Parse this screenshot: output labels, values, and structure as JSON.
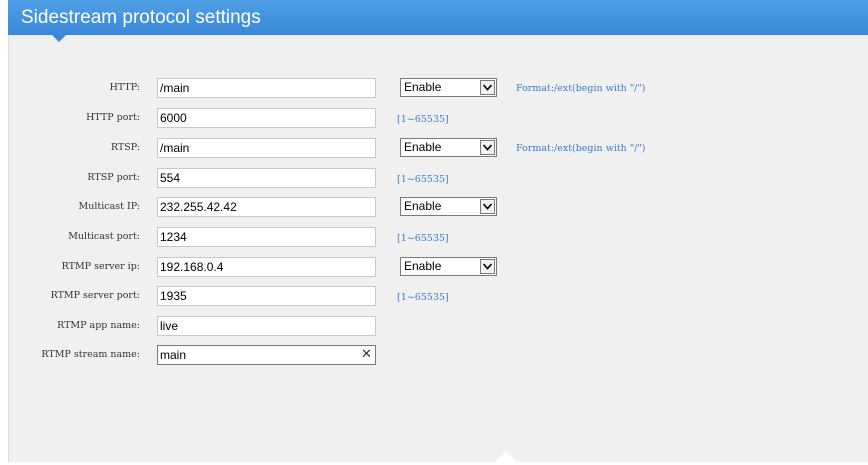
{
  "header": {
    "title": "Sidestream protocol settings"
  },
  "form": {
    "http": {
      "label": "HTTP:",
      "value": "/main",
      "select": "Enable",
      "hint": "Format:/ext(begin with \"/\")"
    },
    "http_port": {
      "label": "HTTP port:",
      "value": "6000",
      "range": "[1~65535]"
    },
    "rtsp": {
      "label": "RTSP:",
      "value": "/main",
      "select": "Enable",
      "hint": "Format:/ext(begin with \"/\")"
    },
    "rtsp_port": {
      "label": "RTSP port:",
      "value": "554",
      "range": "[1~65535]"
    },
    "multicast_ip": {
      "label": "Multicast IP:",
      "value": "232.255.42.42",
      "select": "Enable"
    },
    "multicast_port": {
      "label": "Multicast port:",
      "value": "1234",
      "range": "[1~65535]"
    },
    "rtmp_server_ip": {
      "label": "RTMP server ip:",
      "value": "192.168.0.4",
      "select": "Enable"
    },
    "rtmp_server_port": {
      "label": "RTMP server port:",
      "value": "1935",
      "range": "[1~65535]"
    },
    "rtmp_app_name": {
      "label": "RTMP app name:",
      "value": "live"
    },
    "rtmp_stream_name": {
      "label": "RTMP stream name:",
      "value": "main",
      "clear_icon": "close-icon"
    }
  },
  "colors": {
    "header_bg": "#3a88d8",
    "hint_text": "#3a7cc9",
    "panel_bg": "#f0f0f0"
  }
}
